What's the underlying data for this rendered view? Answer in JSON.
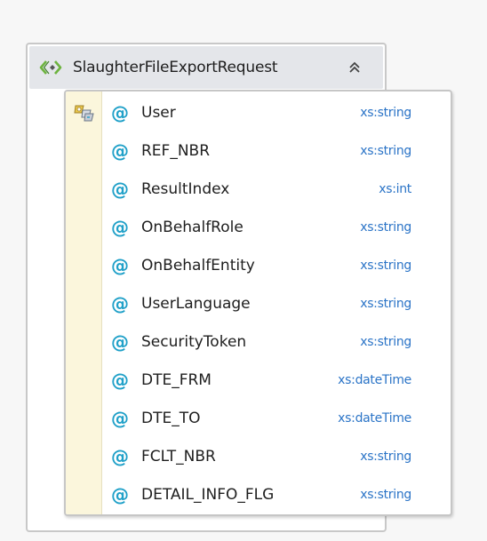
{
  "element": {
    "name": "SlaughterFileExportRequest",
    "icon": "element-icon",
    "collapse_icon": "double-chevron-up-icon",
    "accent_color": "#6db33f"
  },
  "attribute_group": {
    "icon": "attribute-group-icon",
    "at_symbol": "@",
    "at_color": "#1fa0c8",
    "type_color": "#2b74c7",
    "attributes": [
      {
        "name": "User",
        "type": "xs:string"
      },
      {
        "name": "REF_NBR",
        "type": "xs:string"
      },
      {
        "name": "ResultIndex",
        "type": "xs:int"
      },
      {
        "name": "OnBehalfRole",
        "type": "xs:string"
      },
      {
        "name": "OnBehalfEntity",
        "type": "xs:string"
      },
      {
        "name": "UserLanguage",
        "type": "xs:string"
      },
      {
        "name": "SecurityToken",
        "type": "xs:string"
      },
      {
        "name": "DTE_FRM",
        "type": "xs:dateTime"
      },
      {
        "name": "DTE_TO",
        "type": "xs:dateTime"
      },
      {
        "name": "FCLT_NBR",
        "type": "xs:string"
      },
      {
        "name": "DETAIL_INFO_FLG",
        "type": "xs:string"
      }
    ]
  }
}
